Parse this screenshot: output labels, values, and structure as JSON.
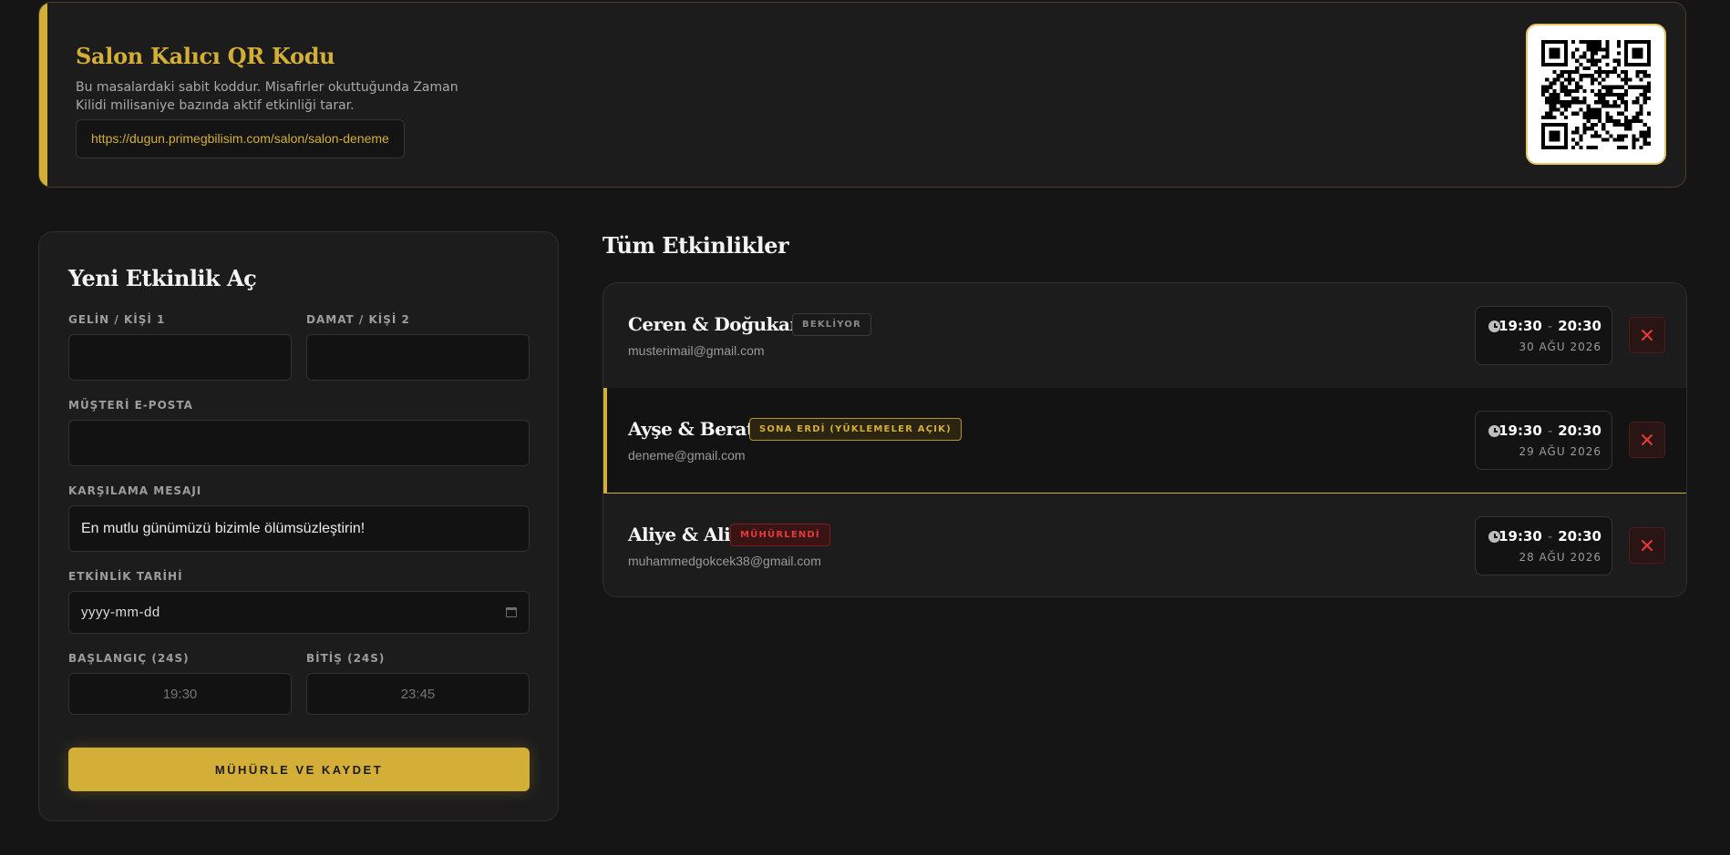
{
  "qr_banner": {
    "title": "Salon Kalıcı QR Kodu",
    "description": "Bu masalardaki sabit koddur. Misafirler okuttuğunda Zaman Kilidi milisaniye bazında aktif etkinliği tarar.",
    "url": "https://dugun.primegbilisim.com/salon/salon-deneme",
    "qr_icon": "qr-code-icon"
  },
  "form": {
    "title": "Yeni Etkinlik Aç",
    "bride_label": "GELİN / KİŞİ 1",
    "bride_value": "",
    "groom_label": "DAMAT / KİŞİ 2",
    "groom_value": "",
    "email_label": "MÜŞTERİ E-POSTA",
    "email_value": "",
    "welcome_label": "KARŞILAMA MESAJI",
    "welcome_value": "En mutlu günümüzü bizimle ölümsüzleştirin!",
    "date_label": "ETKİNLİK TARİHİ",
    "date_placeholder": "yyyy-mm-dd",
    "start_label": "BAŞLANGIÇ (24S)",
    "start_placeholder": "19:30",
    "end_label": "BİTİŞ (24S)",
    "end_placeholder": "23:45",
    "submit_label": "MÜHÜRLE VE KAYDET"
  },
  "events": {
    "title": "Tüm Etkinlikler",
    "items": [
      {
        "names": "Ceren & Doğukan",
        "status": "BEKLİYOR",
        "email": "musterimail@gmail.com",
        "start": "19:30",
        "end": "20:30",
        "date": "30 AĞU 2026"
      },
      {
        "names": "Ayşe & Berat",
        "status": "SONA ERDİ (YÜKLEMELER AÇIK)",
        "email": "deneme@gmail.com",
        "start": "19:30",
        "end": "20:30",
        "date": "29 AĞU 2026"
      },
      {
        "names": "Aliye & Ali",
        "status": "MÜHÜRLENDİ",
        "email": "muhammedgokcek38@gmail.com",
        "start": "19:30",
        "end": "20:30",
        "date": "28 AĞU 2026"
      }
    ],
    "time_separator": "-"
  },
  "colors": {
    "accent": "#d4af37",
    "background": "#151515",
    "card": "#1c1c1c",
    "danger": "#e23b3b"
  }
}
